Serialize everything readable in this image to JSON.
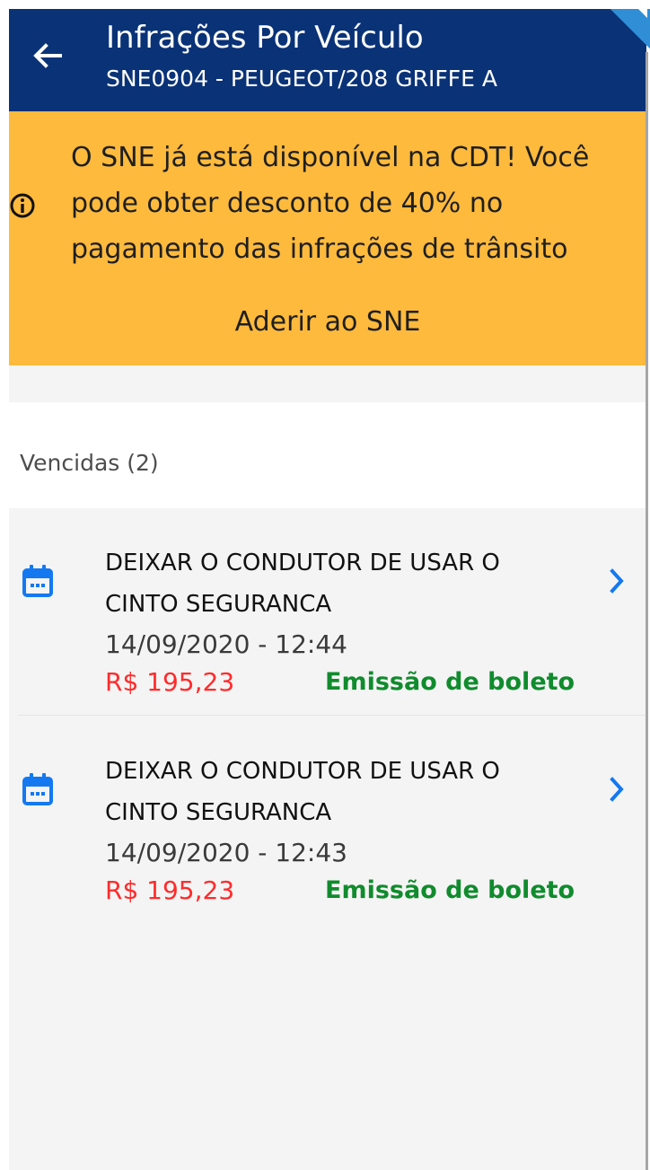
{
  "colors": {
    "app_bar": "#0A3277",
    "banner": "#FDBA3D",
    "overdue_value": "#FF2B2B",
    "action_text": "#108B2D",
    "accent_blue": "#2F8ED6"
  },
  "header": {
    "back_icon": "arrow-left-icon",
    "title": "Infrações Por Veículo",
    "subtitle": "SNE0904 - PEUGEOT/208 GRIFFE A"
  },
  "banner": {
    "icon": "info-icon",
    "lines": [
      "O SNE já está disponível na CDT! Você",
      "pode obter desconto de 40% no",
      "pagamento das infrações de trânsito"
    ],
    "action": "Aderir ao SNE"
  },
  "section": {
    "title": "Vencidas (2)"
  },
  "infractions": [
    {
      "icon": "calendar-icon",
      "title_lines": [
        "DEIXAR O CONDUTOR DE USAR O",
        "CINTO SEGURANCA"
      ],
      "datetime": "14/09/2020 - 12:44",
      "value": "R$ 195,23",
      "action": "Emissão de boleto",
      "chevron_icon": "chevron-right-icon"
    },
    {
      "icon": "calendar-icon",
      "title_lines": [
        "DEIXAR O CONDUTOR DE USAR O",
        "CINTO SEGURANCA"
      ],
      "datetime": "14/09/2020 - 12:43",
      "value": "R$ 195,23",
      "action": "Emissão de boleto",
      "chevron_icon": "chevron-right-icon"
    }
  ]
}
